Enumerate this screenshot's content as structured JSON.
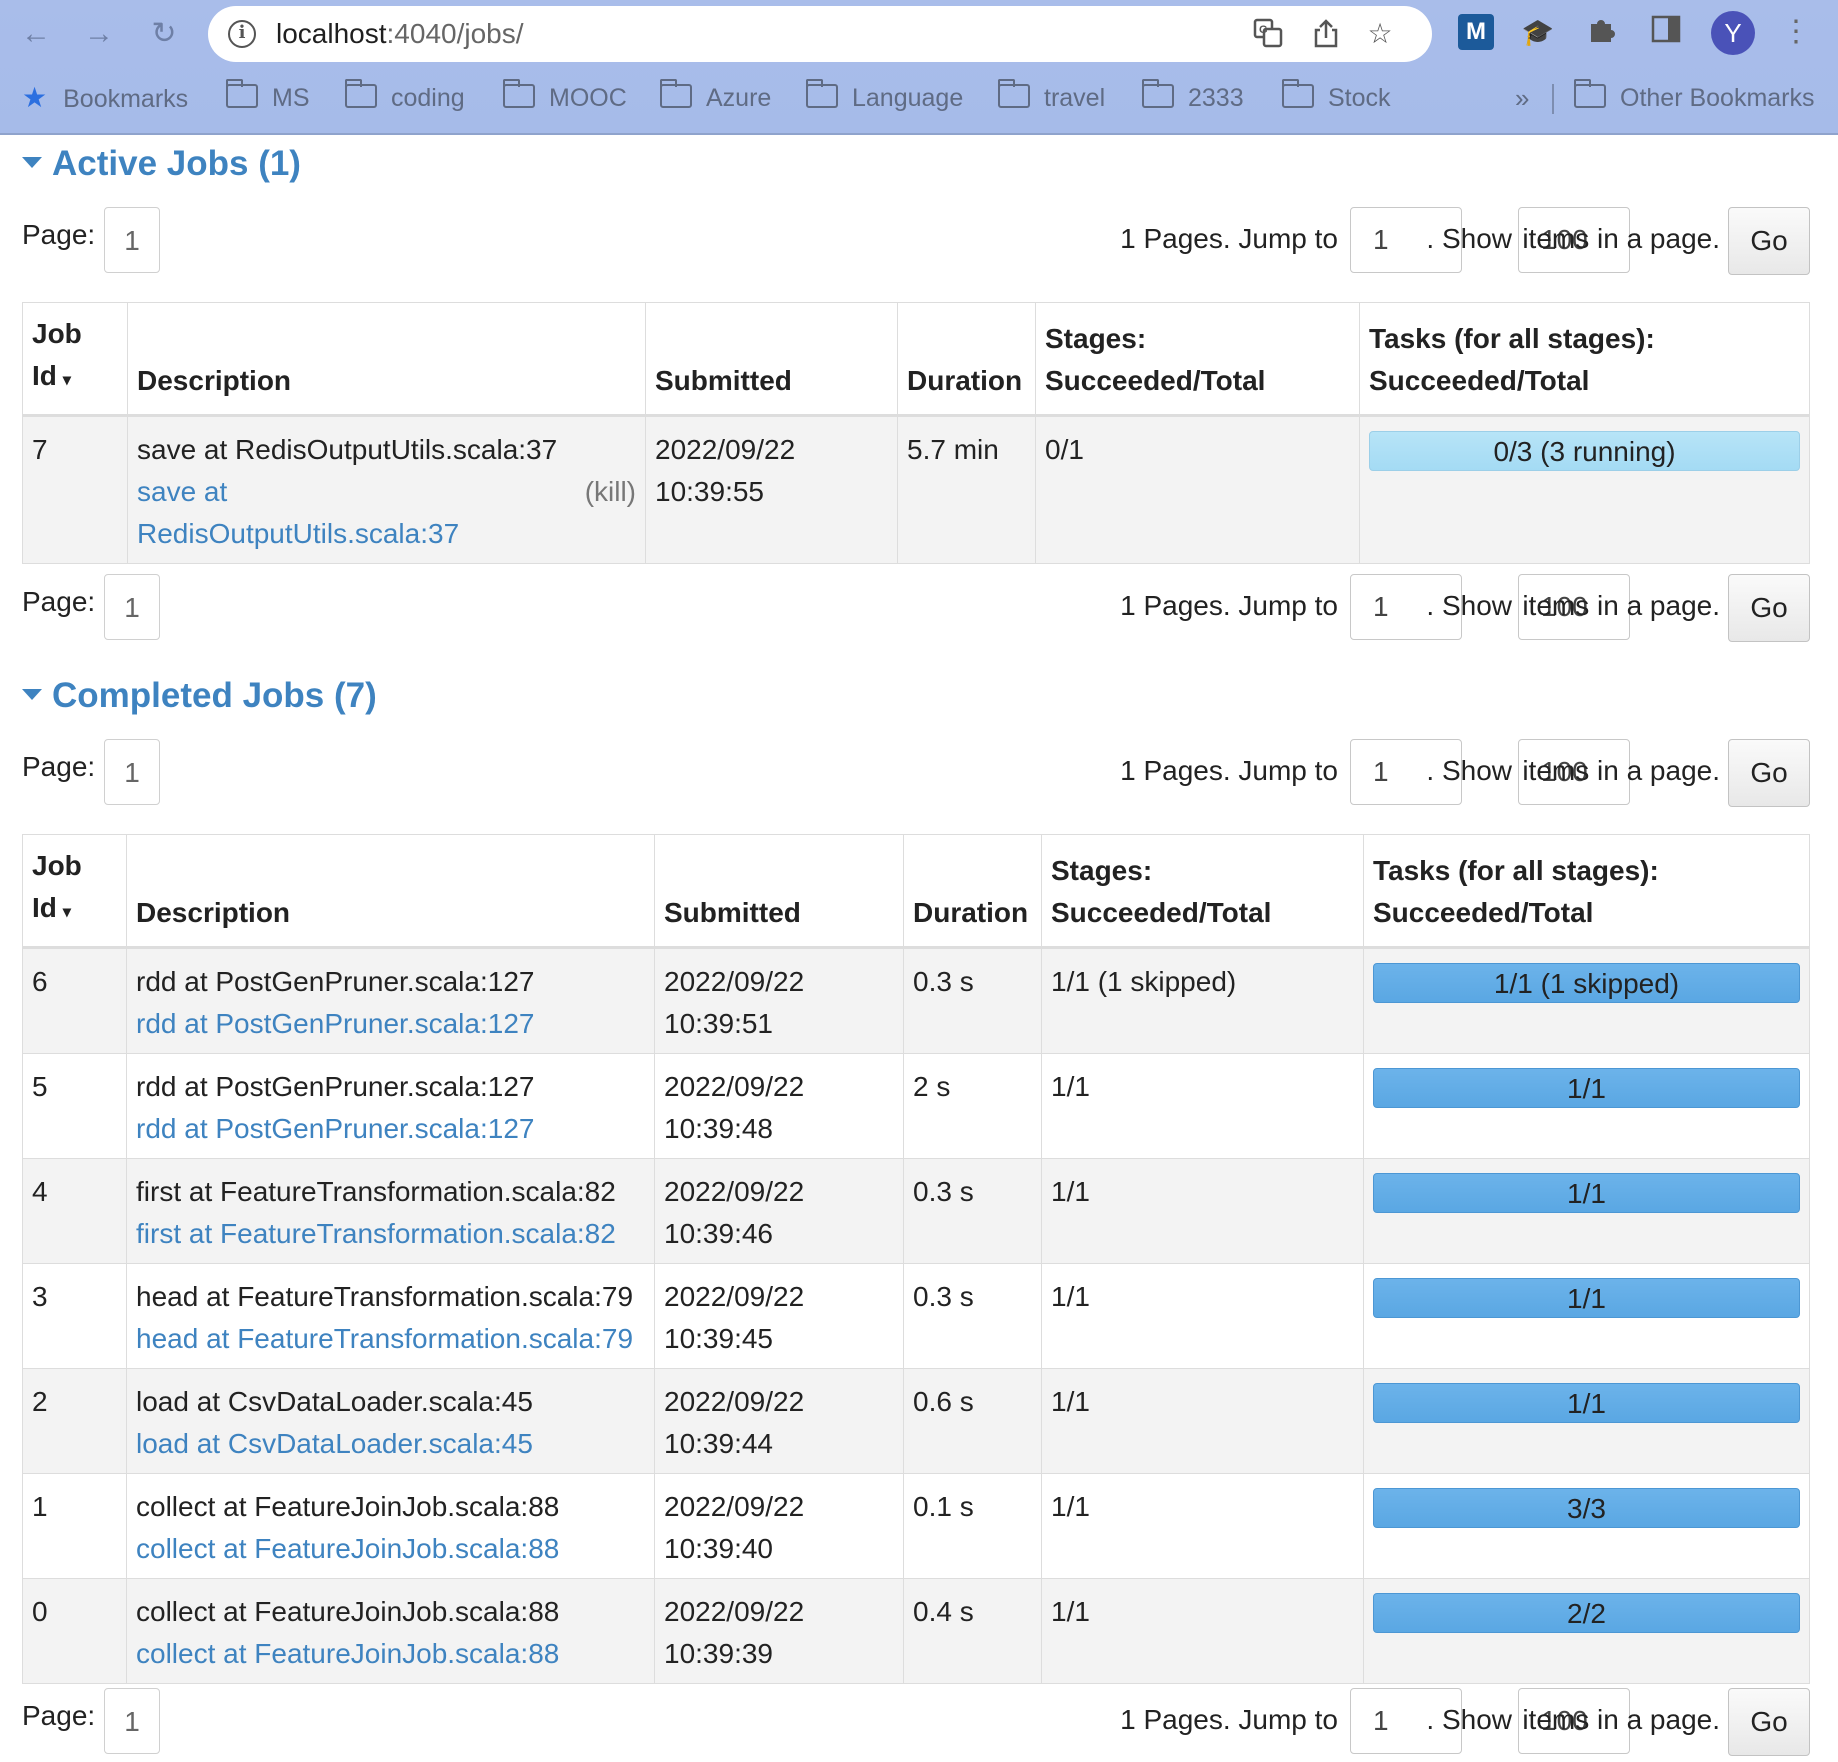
{
  "browser": {
    "url_host": "localhost",
    "url_path": ":4040/jobs/",
    "avatar_letter": "Y",
    "ext_m_label": "M",
    "bookmarks": [
      "Bookmarks",
      "MS",
      "coding",
      "MOOC",
      "Azure",
      "Language",
      "travel",
      "2333",
      "Stock"
    ],
    "overflow": "»",
    "other_bookmarks": "Other Bookmarks"
  },
  "pager": {
    "page_label": "Page:",
    "page_value": "1",
    "pages_text": "1 Pages. Jump to",
    "jump_value": "1",
    "show_text": ". Show",
    "show_value": "100",
    "items_text": "items in a page.",
    "go_label": "Go"
  },
  "active": {
    "title": "Active Jobs (1)",
    "headers": {
      "job_id_1": "Job",
      "job_id_2": "Id",
      "sort": "▾",
      "description": "Description",
      "submitted": "Submitted",
      "duration": "Duration",
      "stages_1": "Stages:",
      "stages_2": "Succeeded/Total",
      "tasks_1": "Tasks (for all stages):",
      "tasks_2": "Succeeded/Total"
    },
    "rows": [
      {
        "id": "7",
        "desc": "save at RedisOutputUtils.scala:37",
        "link_1": "save at",
        "link_2": "RedisOutputUtils.scala:37",
        "kill": "(kill)",
        "date": "2022/09/22",
        "time": "10:39:55",
        "duration": "5.7 min",
        "stages": "0/1",
        "tasks": "0/3 (3 running)"
      }
    ]
  },
  "completed": {
    "title": "Completed Jobs (7)",
    "rows": [
      {
        "id": "6",
        "desc": "rdd at PostGenPruner.scala:127",
        "link": "rdd at PostGenPruner.scala:127",
        "date": "2022/09/22",
        "time": "10:39:51",
        "duration": "0.3 s",
        "stages": "1/1 (1 skipped)",
        "tasks": "1/1 (1 skipped)"
      },
      {
        "id": "5",
        "desc": "rdd at PostGenPruner.scala:127",
        "link": "rdd at PostGenPruner.scala:127",
        "date": "2022/09/22",
        "time": "10:39:48",
        "duration": "2 s",
        "stages": "1/1",
        "tasks": "1/1"
      },
      {
        "id": "4",
        "desc": "first at FeatureTransformation.scala:82",
        "link": "first at FeatureTransformation.scala:82",
        "date": "2022/09/22",
        "time": "10:39:46",
        "duration": "0.3 s",
        "stages": "1/1",
        "tasks": "1/1"
      },
      {
        "id": "3",
        "desc": "head at FeatureTransformation.scala:79",
        "link": "head at FeatureTransformation.scala:79",
        "date": "2022/09/22",
        "time": "10:39:45",
        "duration": "0.3 s",
        "stages": "1/1",
        "tasks": "1/1"
      },
      {
        "id": "2",
        "desc": "load at CsvDataLoader.scala:45",
        "link": "load at CsvDataLoader.scala:45",
        "date": "2022/09/22",
        "time": "10:39:44",
        "duration": "0.6 s",
        "stages": "1/1",
        "tasks": "1/1"
      },
      {
        "id": "1",
        "desc": "collect at FeatureJoinJob.scala:88",
        "link": "collect at FeatureJoinJob.scala:88",
        "date": "2022/09/22",
        "time": "10:39:40",
        "duration": "0.1 s",
        "stages": "1/1",
        "tasks": "3/3"
      },
      {
        "id": "0",
        "desc": "collect at FeatureJoinJob.scala:88",
        "link": "collect at FeatureJoinJob.scala:88",
        "date": "2022/09/22",
        "time": "10:39:39",
        "duration": "0.4 s",
        "stages": "1/1",
        "tasks": "2/2"
      }
    ]
  }
}
